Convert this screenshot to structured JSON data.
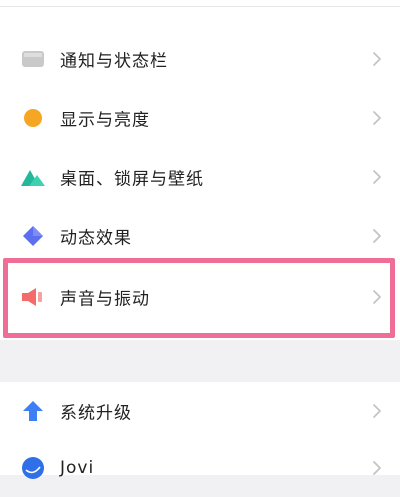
{
  "settings_list": {
    "items": [
      {
        "label": "通知与状态栏",
        "icon": "notification-bar-icon",
        "color": "#c8c8c8"
      },
      {
        "label": "显示与亮度",
        "icon": "brightness-icon",
        "color": "#f5a623"
      },
      {
        "label": "桌面、锁屏与壁纸",
        "icon": "wallpaper-mountain-icon",
        "color": "#2ec4a6"
      },
      {
        "label": "动态效果",
        "icon": "motion-diamond-icon",
        "color": "#5b6ff0"
      },
      {
        "label": "声音与振动",
        "icon": "speaker-icon",
        "color": "#f36b6b"
      }
    ],
    "lower_items": [
      {
        "label": "系统升级",
        "icon": "upgrade-arrow-icon",
        "color": "#3f7ff5"
      },
      {
        "label": "Jovi",
        "icon": "jovi-icon",
        "color": "#2f6fe8"
      }
    ]
  },
  "highlight": {
    "target": "声音与振动",
    "color": "#ef6e98"
  }
}
